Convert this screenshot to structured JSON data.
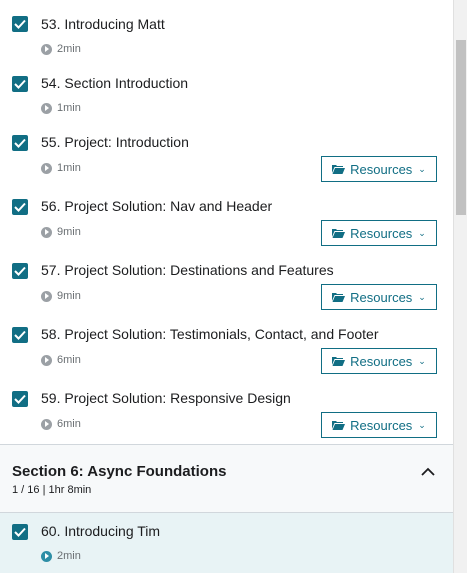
{
  "lectures": [
    {
      "title": "53. Introducing Matt",
      "duration": "2min",
      "has_resources": false
    },
    {
      "title": "54. Section Introduction",
      "duration": "1min",
      "has_resources": false
    },
    {
      "title": "55. Project: Introduction",
      "duration": "1min",
      "has_resources": true
    },
    {
      "title": "56. Project Solution: Nav and Header",
      "duration": "9min",
      "has_resources": true
    },
    {
      "title": "57. Project Solution: Destinations and Features",
      "duration": "9min",
      "has_resources": true
    },
    {
      "title": "58. Project Solution: Testimonials, Contact, and Footer",
      "duration": "6min",
      "has_resources": true
    },
    {
      "title": "59. Project Solution: Responsive Design",
      "duration": "6min",
      "has_resources": true
    }
  ],
  "resources_label": "Resources",
  "section": {
    "title": "Section 6: Async Foundations",
    "progress": "1 / 16 | 1hr 8min"
  },
  "active_lecture": {
    "title": "60. Introducing Tim",
    "duration": "2min"
  },
  "colors": {
    "accent": "#116e84",
    "active_bg": "#e8f3f5"
  }
}
